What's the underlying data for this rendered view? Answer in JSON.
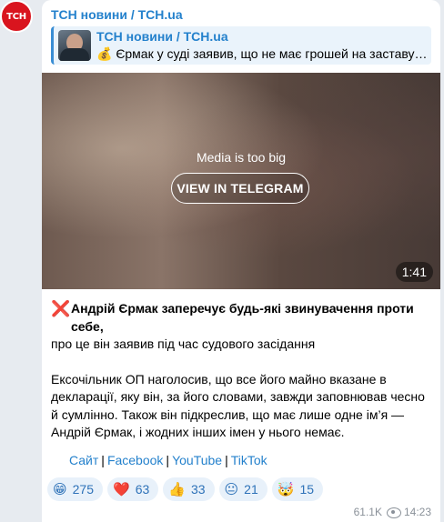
{
  "channel": {
    "avatar_text": "ТСН",
    "avatar_color": "#d9141e",
    "name": "ТСН новини / TCH.ua"
  },
  "reply": {
    "title": "ТСН новини / TCH.ua",
    "icon": "money-bag-icon",
    "text": "💰 Єрмак у суді заявив, що не має грошей на заставу …"
  },
  "media": {
    "note": "Media is too big",
    "button_label": "VIEW IN TELEGRAM",
    "duration": "1:41"
  },
  "post": {
    "lead_icon": "cross-mark-icon",
    "lead_mark": "❌",
    "headline": "Андрій Єрмак заперечує будь-які звинувачення проти себе,",
    "headline_rest": "про це він заявив під час судового засідання",
    "paragraph": "Ексочільник ОП наголосив, що все його майно вказане в декларації, яку він, за його словами, завжди заповнював чесно й сумлінно. Також він підкреслив, що має лише одне ім’я — Андрій Єрмак, і жодних інших імен у нього немає."
  },
  "links": [
    "Сайт",
    "Facebook",
    "YouTube",
    "TikTok"
  ],
  "link_separator": "|",
  "reactions": [
    {
      "icon": "laughing-face-icon",
      "emoji": "😁",
      "count": "275"
    },
    {
      "icon": "red-heart-icon",
      "emoji": "❤️",
      "count": "63"
    },
    {
      "icon": "thumbs-up-icon",
      "emoji": "👍",
      "count": "33"
    },
    {
      "icon": "neutral-face-icon",
      "emoji": "😐",
      "count": "21"
    },
    {
      "icon": "exploding-head-icon",
      "emoji": "🤯",
      "count": "15"
    }
  ],
  "meta": {
    "views": "61.1K",
    "time": "14:23"
  },
  "colors": {
    "accent": "#2481cc",
    "background": "#e7ebf0",
    "reaction_bg": "#e8f1fa"
  }
}
